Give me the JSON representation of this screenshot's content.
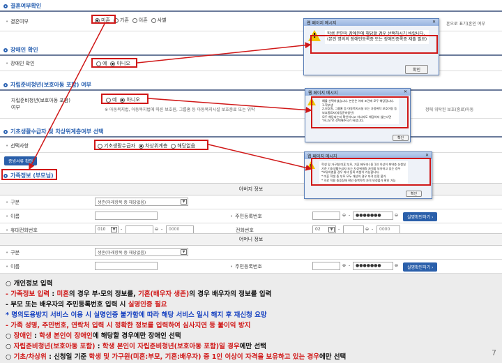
{
  "marital": {
    "section_title": "결혼여부확인",
    "row_label": "결혼여부",
    "options": [
      "미혼",
      "기혼",
      "이혼",
      "사별"
    ],
    "selected_index": 0,
    "right_note": "혼으로 표기(혼인 여부"
  },
  "disabled": {
    "section_title": "장애인 확인",
    "row_label": "장애인 확인",
    "options": [
      "예",
      "아니오"
    ],
    "selected_index": 1
  },
  "youth": {
    "section_title": "자립준비청년(보호아동 포함) 여부",
    "row_label_1": "자립준비청년(보호아동 포함)",
    "row_label_2": "여부",
    "options": [
      "예",
      "아니오"
    ],
    "selected_index": 1,
    "note": "※ 아동복지법, 아동복지법에 따른 보호원, 그룹홈 등 아동복지시설 보호종료 또는 위탁",
    "note_right": "정에 위탁된 보호(종료)아동"
  },
  "basic": {
    "section_title": "기초생활수급자 및 차상위계층여부 선택",
    "row_label": "선택사항",
    "options": [
      "기초생활수급자",
      "차상위계층",
      "해당없음"
    ],
    "selected_index": 1,
    "confirm_button": "증빙서류 확인"
  },
  "family": {
    "section_title": "가족정보 (부모님)",
    "father_header": "아버지 정보",
    "mother_header": "어머니 정보",
    "label_type": "구분",
    "label_name": "이름",
    "label_mobile": "휴대전화번호",
    "label_ssn": "주민등록번호",
    "label_phone": "전화번호",
    "type_select_father": "생존(아래항목 중 해당없음)",
    "type_select_mother": "생존(아래항목 중 해당없음)",
    "ssn_mask": "●●●●●●●",
    "verify_button": "실명확인하기",
    "mobile_prefix": "010",
    "mobile_mid": "",
    "mobile_last": "0000",
    "phone_prefix": "02",
    "phone_last": "0000"
  },
  "dialogs": [
    {
      "title": "웹 페이지 메시지",
      "message": "학생 본인이 장애인에 해당할 경우 선택하시기 바랍니다.\n(본인 명의의 장애인등록증 또는 장애인증록증 제출 필요)",
      "button": "확인"
    },
    {
      "title": "웹 페이지 메시지",
      "message": "예를 선택하셨습니다. 본인은 아래 조건에 모두 해당합니다.\n1.학부생\n2.보호원, 그룹홈 등 아동복지시설 또는 가정위탁 보호아동 등\n보호종료자(자립준비청년)\n모두 해당되는지 확인하시고 하나라도 해당하지 않는다면\n'아니오'로 선택해주시기 바랍니다.",
      "button": "확인"
    },
    {
      "title": "웹 페이지 메시지",
      "message": "학생 및 가구원(미혼:부모, 기혼:배우자) 중 1인 이상이 취약층 신청일\n기준 기초생활수급자 또는 차상위계층 자격을 보유하고 있는 경우\n*보유하였을 경우 자녀 등록 지원이 가능합니다.\n* 미혼 학생 중 부모 모두 대상의 경우 자격 인정 불가\n* 의료 적용 중증장애 확인 중복학적 자격 인정불가 확인 가능",
      "button": "확인"
    }
  ],
  "bottom": {
    "line1": "○ 개인정보 입력",
    "line2_a": " - ",
    "line2_b": "가족정보 입력",
    "line2_c": " : ",
    "line2_d": "미혼",
    "line2_e": "의 경우 부·모의 정보를, ",
    "line2_f": "기혼(배우자 생존)",
    "line2_g": "의 경우 배우자의 정보를 입력",
    "line3_a": " - 부모 또는 배우자의 주민등록번호 입력 시 ",
    "line3_b": "실명인증 필요",
    "line4": "   * 명의도용방지 서비스 이용 시 실명인증 불가함에 따라 해당 서비스 일시 해지 후 재신청 요망",
    "line5": " - 가족 성명, 주민번호, 연락처 입력 시 정확한 정보를 입력하여 심사지연 등 불이익 방지",
    "line6_a": "○ ",
    "line6_b": "장애인",
    "line6_c": " : ",
    "line6_d": "학생 본인이 장애인",
    "line6_e": "에 해당할 경우에만 장애인 선택",
    "line7_a": "○ ",
    "line7_b": "자립준비청년(보호아동 포함)",
    "line7_c": " : ",
    "line7_d": "학생 본인이 자립준비청년(보호아동 포함)일 경우",
    "line7_e": "에만 선택",
    "line8_a": "○ ",
    "line8_b": "기초/차상위",
    "line8_c": " : 신청일 기준 ",
    "line8_d": "학생 및 가구원(미혼:부모, 기혼:배우자) 중 1인 이상이 자격을 보유하고 있는 경우",
    "line8_e": "에만 선택",
    "page_number": "7"
  }
}
